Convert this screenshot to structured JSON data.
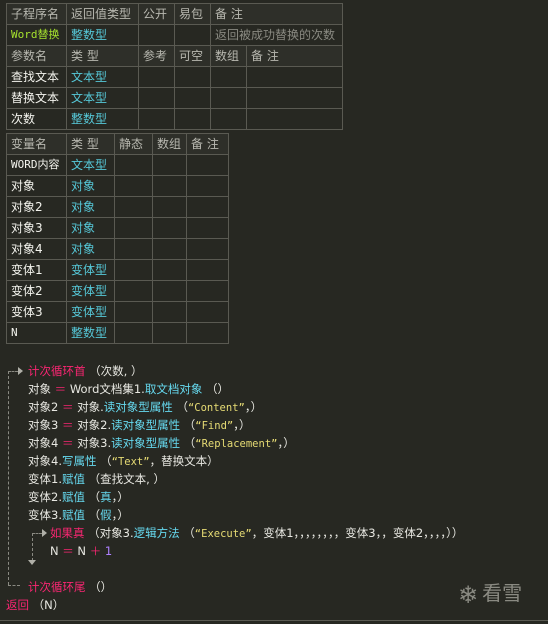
{
  "sub_table": {
    "headers": [
      "子程序名",
      "返回值类型",
      "公开",
      "易包",
      "备 注"
    ],
    "row": {
      "name": "Word替换",
      "type": "整数型",
      "public": "",
      "pkg": "",
      "note": "返回被成功替换的次数"
    },
    "param_headers": [
      "参数名",
      "类 型",
      "参考",
      "可空",
      "数组",
      "备 注"
    ],
    "params": [
      {
        "name": "查找文本",
        "type": "文本型"
      },
      {
        "name": "替换文本",
        "type": "文本型"
      },
      {
        "name": "次数",
        "type": "整数型"
      }
    ]
  },
  "var_table": {
    "headers": [
      "变量名",
      "类 型",
      "静态",
      "数组",
      "备 注"
    ],
    "vars": [
      {
        "name": "WORD内容",
        "type": "文本型"
      },
      {
        "name": "对象",
        "type": "对象"
      },
      {
        "name": "对象2",
        "type": "对象"
      },
      {
        "name": "对象3",
        "type": "对象"
      },
      {
        "name": "对象4",
        "type": "对象"
      },
      {
        "name": "变体1",
        "type": "变体型"
      },
      {
        "name": "变体2",
        "type": "变体型"
      },
      {
        "name": "变体3",
        "type": "变体型"
      },
      {
        "name": "N",
        "type": "整数型"
      }
    ]
  },
  "code": {
    "loop_head": {
      "kw": "计次循环首",
      "args": "（次数, ）"
    },
    "l1": {
      "a": "对象",
      "op": "＝",
      "b": "Word文档集1.",
      "fn": "取文档对象",
      "c": "（）"
    },
    "l2": {
      "a": "对象2",
      "op": "＝",
      "b": "对象.",
      "fn": "读对象型属性",
      "c1": "（",
      "s": "“Content”",
      "c2": "，）"
    },
    "l3": {
      "a": "对象3",
      "op": "＝",
      "b": "对象2.",
      "fn": "读对象型属性",
      "c1": "（",
      "s": "“Find”",
      "c2": "，）"
    },
    "l4": {
      "a": "对象4",
      "op": "＝",
      "b": "对象3.",
      "fn": "读对象型属性",
      "c1": "（",
      "s": "“Replacement”",
      "c2": "，）"
    },
    "l5": {
      "a": "对象4.",
      "fn": "写属性",
      "c1": "（",
      "s": "“Text”",
      "c2": "，替换文本）"
    },
    "l6": {
      "a": "变体1.",
      "fn": "赋值",
      "c": "（查找文本, ）"
    },
    "l7": {
      "a": "变体2.",
      "fn": "赋值",
      "c1": "（",
      "k": "真",
      "c2": "，）"
    },
    "l8": {
      "a": "变体3.",
      "fn": "赋值",
      "c1": "（",
      "k": "假",
      "c2": "，）"
    },
    "if_line": {
      "kw": "如果真",
      "a": "（对象3.",
      "fn": "逻辑方法",
      "c1": "（",
      "s": "“Execute”",
      "c2": "，变体1，，，，，，，，变体3，，变体2，，，，））"
    },
    "n_line": {
      "a": "N",
      "op": "＝",
      "b": "N",
      "plus": "＋",
      "num": "1"
    },
    "loop_tail": {
      "kw": "计次循环尾",
      "args": "（）"
    },
    "ret": {
      "kw": "返回",
      "args": "（N）"
    }
  },
  "watermark": {
    "icon": "snowflake-icon",
    "text": "看雪"
  }
}
